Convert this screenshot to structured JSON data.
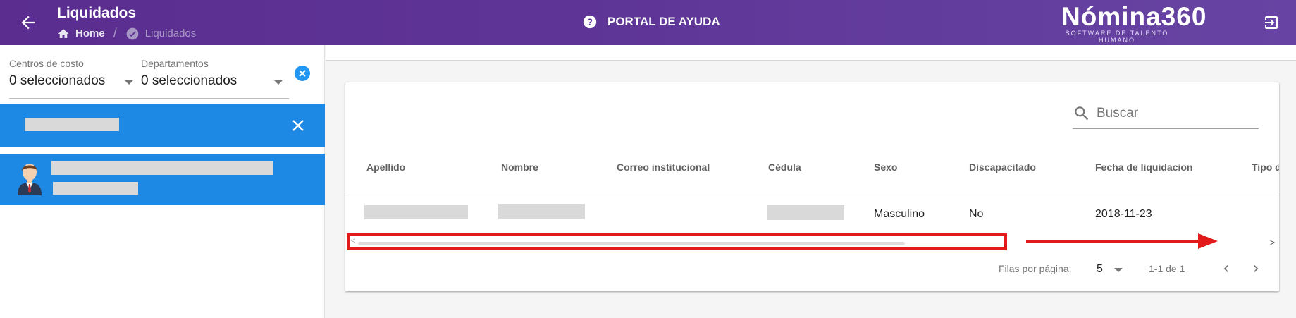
{
  "header": {
    "title": "Liquidados",
    "breadcrumb": {
      "home": "Home",
      "separator": "/",
      "current": "Liquidados"
    },
    "help_label": "PORTAL DE AYUDA",
    "brand_name": "Nómina360",
    "brand_tagline": "SOFTWARE DE TALENTO HUMANO",
    "icons": {
      "back": "arrow-left-icon",
      "home": "home-icon",
      "current": "check-circle-icon",
      "help": "help-circle-icon",
      "logout": "logout-icon"
    },
    "colors": {
      "start": "#5a2d8f",
      "end": "#6744a3"
    }
  },
  "sidebar": {
    "filters": [
      {
        "label": "Centros de costo",
        "value": "0 seleccionados"
      },
      {
        "label": "Departamentos",
        "value": "0 seleccionados"
      }
    ],
    "accent": "#1e88e5"
  },
  "table": {
    "search_placeholder": "Buscar",
    "columns": [
      "Apellido",
      "Nombre",
      "Correo institucional",
      "Cédula",
      "Sexo",
      "Discapacitado",
      "Fecha de liquidacion",
      "Tipo de"
    ],
    "rows": [
      {
        "apellido": "",
        "nombre": "",
        "correo": "",
        "cedula": "",
        "sexo": "Masculino",
        "discapacitado": "No",
        "fecha": "2018-11-23"
      }
    ],
    "pagination": {
      "rows_label": "Filas por página:",
      "rows_value": "5",
      "range": "1-1 de 1"
    }
  },
  "annotation": {
    "color": "#e21a1a"
  }
}
